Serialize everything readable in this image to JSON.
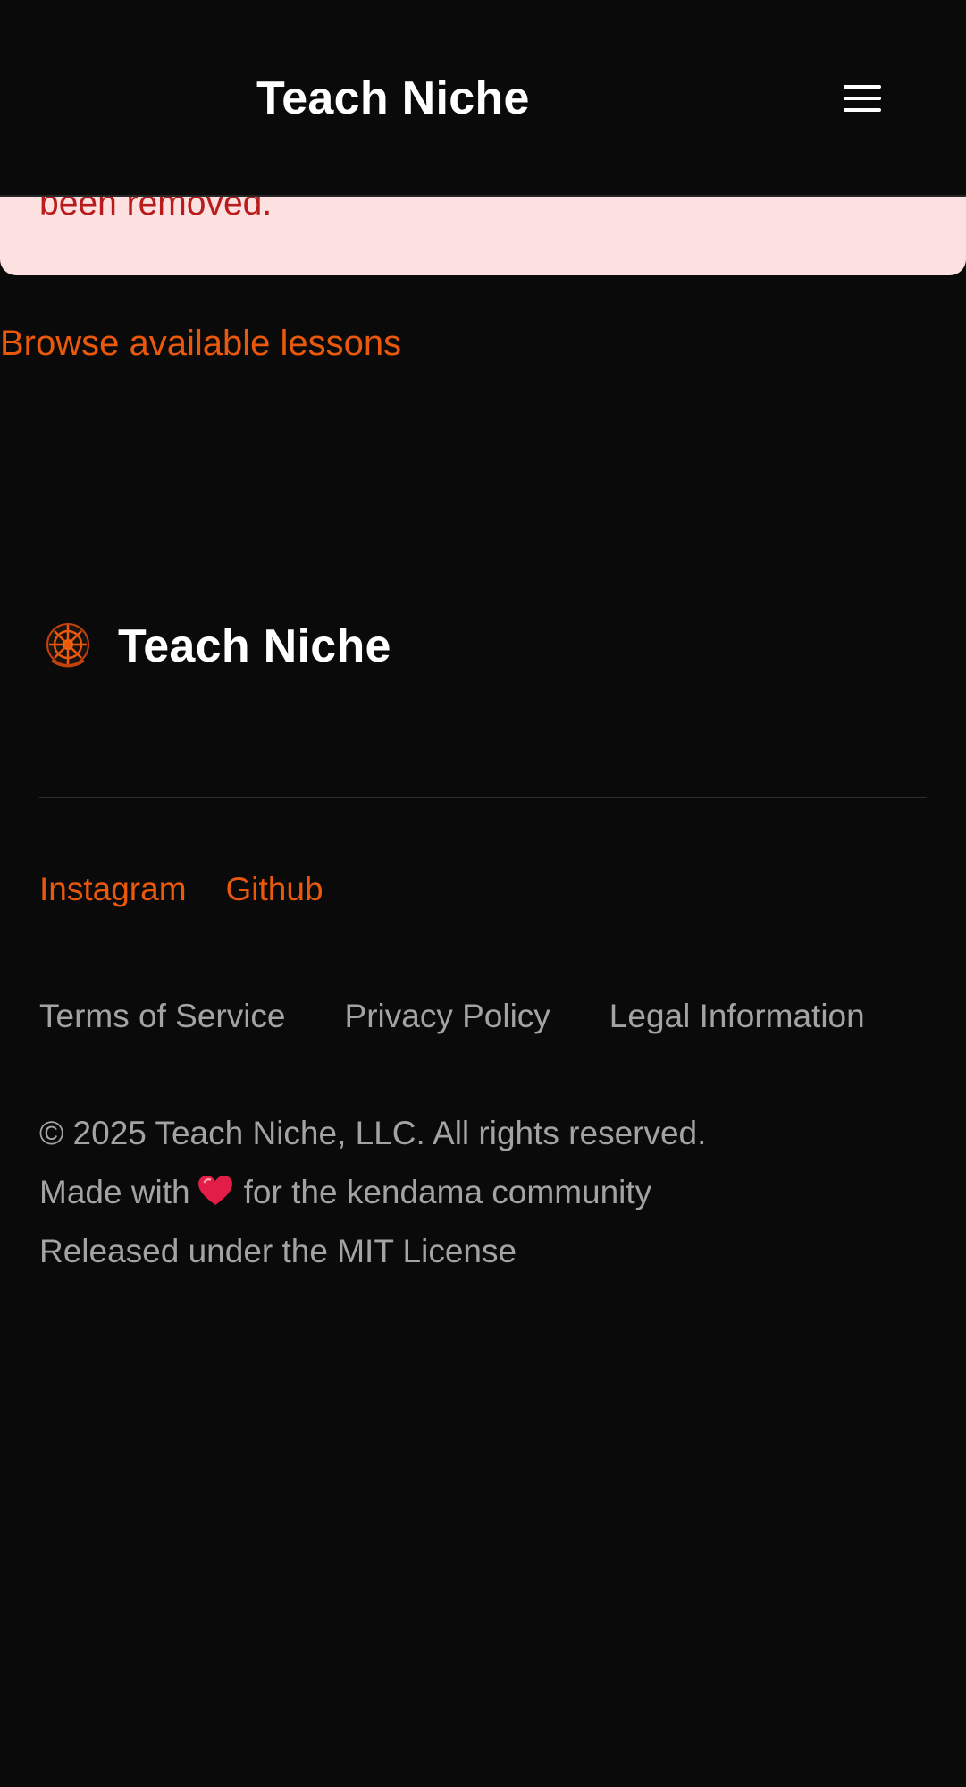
{
  "header": {
    "title": "Teach Niche",
    "menu_icon": "hamburger-menu-icon"
  },
  "alert": {
    "text": "been removed.",
    "background": "#fde1e1",
    "text_color": "#b91c1c"
  },
  "browse_link": {
    "label": "Browse available lessons"
  },
  "footer": {
    "brand": {
      "title": "Teach Niche",
      "logo_icon": "teach-niche-logo-icon"
    },
    "social_links": [
      "Instagram",
      "Github"
    ],
    "legal_links": [
      "Terms of Service",
      "Privacy Policy",
      "Legal Information"
    ],
    "copyright": "© 2025 Teach Niche, LLC. All rights reserved.",
    "made_with_prefix": "Made with",
    "made_with_suffix": "for the kendama community",
    "heart_icon": "red-heart-icon",
    "license": "Released under the MIT License"
  },
  "colors": {
    "background": "#0a0a0a",
    "accent": "#ea580c",
    "muted_text": "#a3a3a3",
    "heading_text": "#ffffff"
  }
}
